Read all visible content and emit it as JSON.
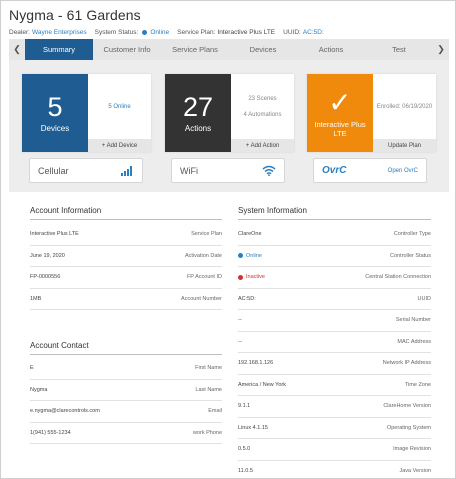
{
  "page": {
    "title": "Nygma - 61 Gardens"
  },
  "meta": {
    "dealer_label": "Dealer:",
    "dealer_value": "Wayne Enterprises",
    "status_label": "System Status:",
    "status_value": "Online",
    "status_color": "#2a7fc1",
    "plan_label": "Service Plan:",
    "plan_value": "Interactive Plus LTE",
    "uuid_label": "UUID:",
    "uuid_value": "AC:5D:"
  },
  "tabs": [
    {
      "label": "Summary",
      "active": true
    },
    {
      "label": "Customer Info"
    },
    {
      "label": "Service Plans"
    },
    {
      "label": "Devices"
    },
    {
      "label": "Actions"
    },
    {
      "label": "Test"
    }
  ],
  "cards": {
    "devices": {
      "count": "5",
      "label": "Devices",
      "detail": "5 Online",
      "action": "+ Add Device",
      "color": "#1f5c92"
    },
    "actions": {
      "count": "27",
      "label": "Actions",
      "detail1": "23 Scenes",
      "detail2": "4 Automations",
      "action": "+ Add Action",
      "color": "#333333"
    },
    "plan": {
      "check": "✓",
      "label": "Interactive Plus LTE",
      "detail": "Enrolled: 06/19/2020",
      "action": "Update Plan",
      "color": "#ef8a0c"
    }
  },
  "services": {
    "cellular": {
      "label": "Cellular",
      "icon": "cellular-signal-icon"
    },
    "wifi": {
      "label": "WiFi",
      "icon": "wifi-icon"
    },
    "ovrc": {
      "logo": "OvrC",
      "link": "Open OvrC"
    }
  },
  "account_info": {
    "title": "Account Information",
    "rows": [
      {
        "value": "Interactive Plus LTE",
        "key": "Service Plan"
      },
      {
        "value": "June 19, 2020",
        "key": "Activation Date"
      },
      {
        "value": "FP-0000556",
        "key": "FP Account ID"
      },
      {
        "value": "1MB",
        "key": "Account Number"
      }
    ]
  },
  "account_contact": {
    "title": "Account Contact",
    "rows": [
      {
        "value": "E",
        "key": "First Name"
      },
      {
        "value": "Nygma",
        "key": "Last Name"
      },
      {
        "value": "e.nygma@clarecontrols.com",
        "key": "Email"
      },
      {
        "value": "1(941) 555-1234",
        "key": "work Phone"
      }
    ]
  },
  "system_info": {
    "title": "System Information",
    "rows": [
      {
        "value": "ClareOne",
        "key": "Controller Type"
      },
      {
        "value": "Online",
        "key": "Controller Status",
        "dot": "#2a7fc1"
      },
      {
        "value": "Inactive",
        "key": "Central Station Connection",
        "dot": "#d32f2f"
      },
      {
        "value": "AC:5D:",
        "key": "UUID"
      },
      {
        "value": "--",
        "key": "Serial Number"
      },
      {
        "value": "--",
        "key": "MAC Address"
      },
      {
        "value": "192.168.1.126",
        "key": "Network IP Address"
      },
      {
        "value": "America / New York",
        "key": "Time Zone"
      },
      {
        "value": "9.1.1",
        "key": "ClareHome Version"
      },
      {
        "value": "Linux 4.1.15",
        "key": "Operating System"
      },
      {
        "value": "0.5.0",
        "key": "Image Revision"
      },
      {
        "value": "11.0.5",
        "key": "Java Version"
      }
    ]
  }
}
